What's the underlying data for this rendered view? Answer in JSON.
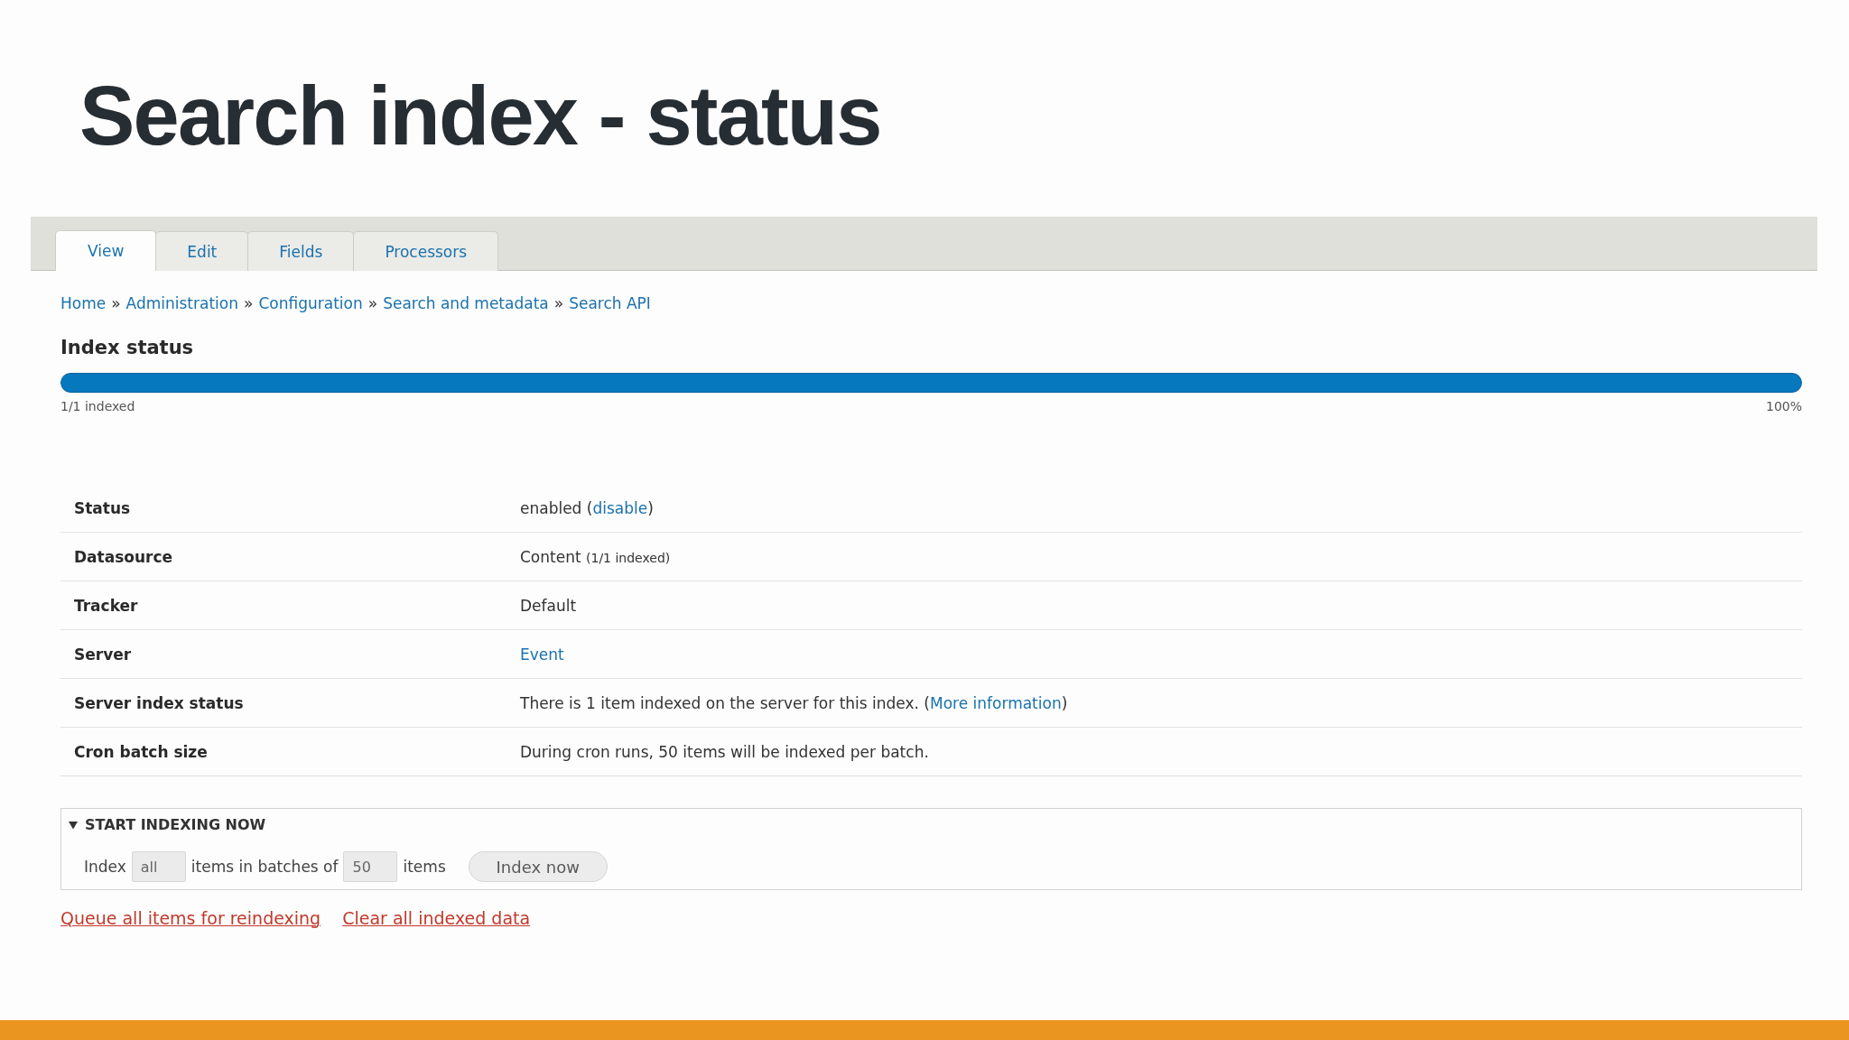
{
  "slide": {
    "title": "Search index - status"
  },
  "tabs": [
    {
      "label": "View",
      "selected": true
    },
    {
      "label": "Edit",
      "selected": false
    },
    {
      "label": "Fields",
      "selected": false
    },
    {
      "label": "Processors",
      "selected": false
    }
  ],
  "breadcrumb": [
    {
      "kind": "link",
      "text": "Home"
    },
    {
      "kind": "separator",
      "text": "»"
    },
    {
      "kind": "link",
      "text": "Administration"
    },
    {
      "kind": "separator",
      "text": "»"
    },
    {
      "kind": "link",
      "text": "Configuration"
    },
    {
      "kind": "separator",
      "text": "»"
    },
    {
      "kind": "link",
      "text": "Search and metadata"
    },
    {
      "kind": "separator",
      "text": "»"
    },
    {
      "kind": "link",
      "text": "Search API"
    }
  ],
  "section_title": "Index status",
  "progress": {
    "level": 1.0,
    "caption": "1/1 indexed",
    "percent": "100%"
  },
  "details": [
    {
      "label": "Status",
      "value": [
        {
          "kind": "text",
          "text": "enabled ("
        },
        {
          "kind": "link",
          "text": "disable"
        },
        {
          "kind": "text",
          "text": ")"
        }
      ]
    },
    {
      "label": "Datasource",
      "value": [
        {
          "kind": "text",
          "text": "Content "
        },
        {
          "kind": "note",
          "text": "(1/1 indexed)"
        }
      ]
    },
    {
      "label": "Tracker",
      "value": [
        {
          "kind": "text",
          "text": "Default"
        }
      ]
    },
    {
      "label": "Server",
      "value": [
        {
          "kind": "link",
          "text": "Event"
        }
      ]
    },
    {
      "label": "Server index status",
      "value": [
        {
          "kind": "text",
          "text": "There is 1 item indexed on the server for this index. ("
        },
        {
          "kind": "link",
          "text": "More information"
        },
        {
          "kind": "text",
          "text": ")"
        }
      ]
    },
    {
      "label": "Cron batch size",
      "value": [
        {
          "kind": "text",
          "text": "During cron runs, 50 items will be indexed per batch."
        }
      ]
    }
  ],
  "start_indexing": {
    "legend": "START INDEXING NOW",
    "expanded": true,
    "row": [
      {
        "kind": "label",
        "text": "Index"
      },
      {
        "kind": "input",
        "value": "all"
      },
      {
        "kind": "label",
        "text": "items in batches of"
      },
      {
        "kind": "input",
        "value": "50"
      },
      {
        "kind": "label",
        "text": "items"
      },
      {
        "kind": "button",
        "text": "Index now"
      }
    ]
  },
  "actions": [
    {
      "text": "Queue all items for reindexing"
    },
    {
      "text": "Clear all indexed data"
    }
  ]
}
